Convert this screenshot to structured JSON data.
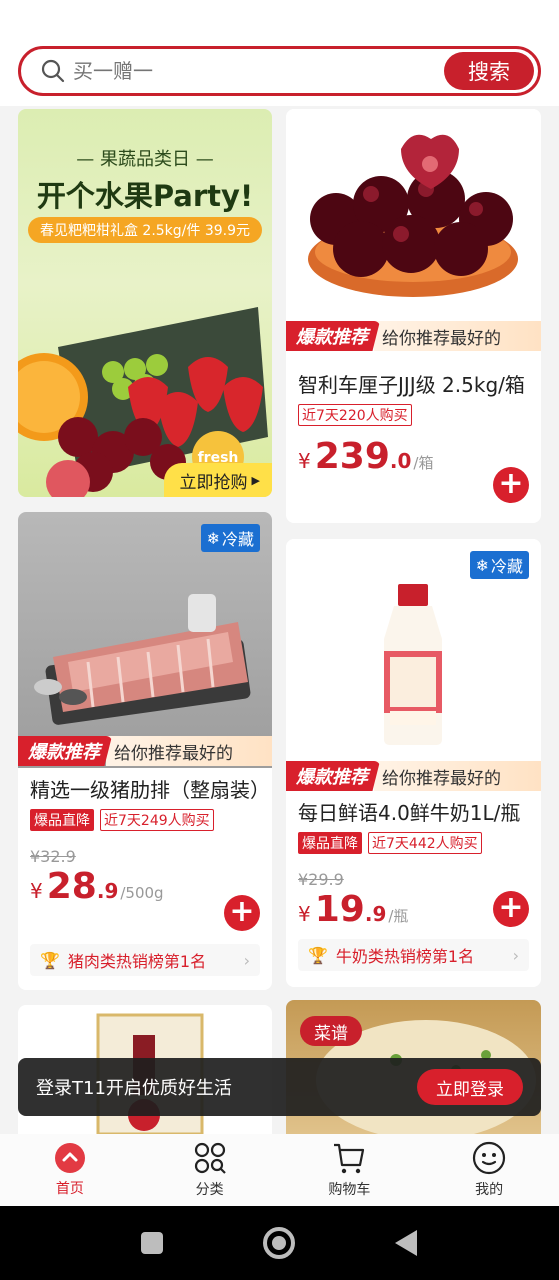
{
  "search": {
    "placeholder": "买一赠一",
    "button_label": "搜索"
  },
  "banner": {
    "subtitle": "— 果蔬品类日 —",
    "title": "开个水果Party!",
    "offer": "春见粑粑柑礼盒 2.5kg/件 39.9元",
    "sticker": "fresh",
    "cta": "立即抢购"
  },
  "promo": {
    "left": "爆款推荐",
    "right": "给你推荐最好的"
  },
  "products": [
    {
      "title": "智利车厘子JJJ级 2.5kg/箱",
      "tags": [
        "近7天220人购买"
      ],
      "price_int": "239",
      "price_dec": ".0",
      "unit": "/箱",
      "yen": "¥"
    },
    {
      "title": "精选一级猪肋排（整扇装）",
      "badge": "冷藏",
      "tag_red": "爆品直降",
      "tag_outline": "近7天249人购买",
      "orig_price": "¥32.9",
      "price_int": "28",
      "price_dec": ".9",
      "unit": "/500g",
      "yen": "¥",
      "rank": "猪肉类热销榜第1名"
    },
    {
      "title": "每日鲜语4.0鲜牛奶1L/瓶",
      "badge": "冷藏",
      "tag_red": "爆品直降",
      "tag_outline": "近7天442人购买",
      "orig_price": "¥29.9",
      "price_int": "19",
      "price_dec": ".9",
      "unit": "/瓶",
      "yen": "¥",
      "rank": "牛奶类热销榜第1名"
    },
    {
      "badge": "菜谱"
    }
  ],
  "toast": {
    "text": "登录T11开启优质好生活",
    "button": "立即登录"
  },
  "nav": [
    {
      "label": "首页",
      "icon": "home-icon",
      "active": true
    },
    {
      "label": "分类",
      "icon": "category-icon"
    },
    {
      "label": "购物车",
      "icon": "cart-icon"
    },
    {
      "label": "我的",
      "icon": "profile-icon"
    }
  ],
  "colors": {
    "accent": "#c8202c",
    "cold_badge": "#1b6fd1"
  }
}
